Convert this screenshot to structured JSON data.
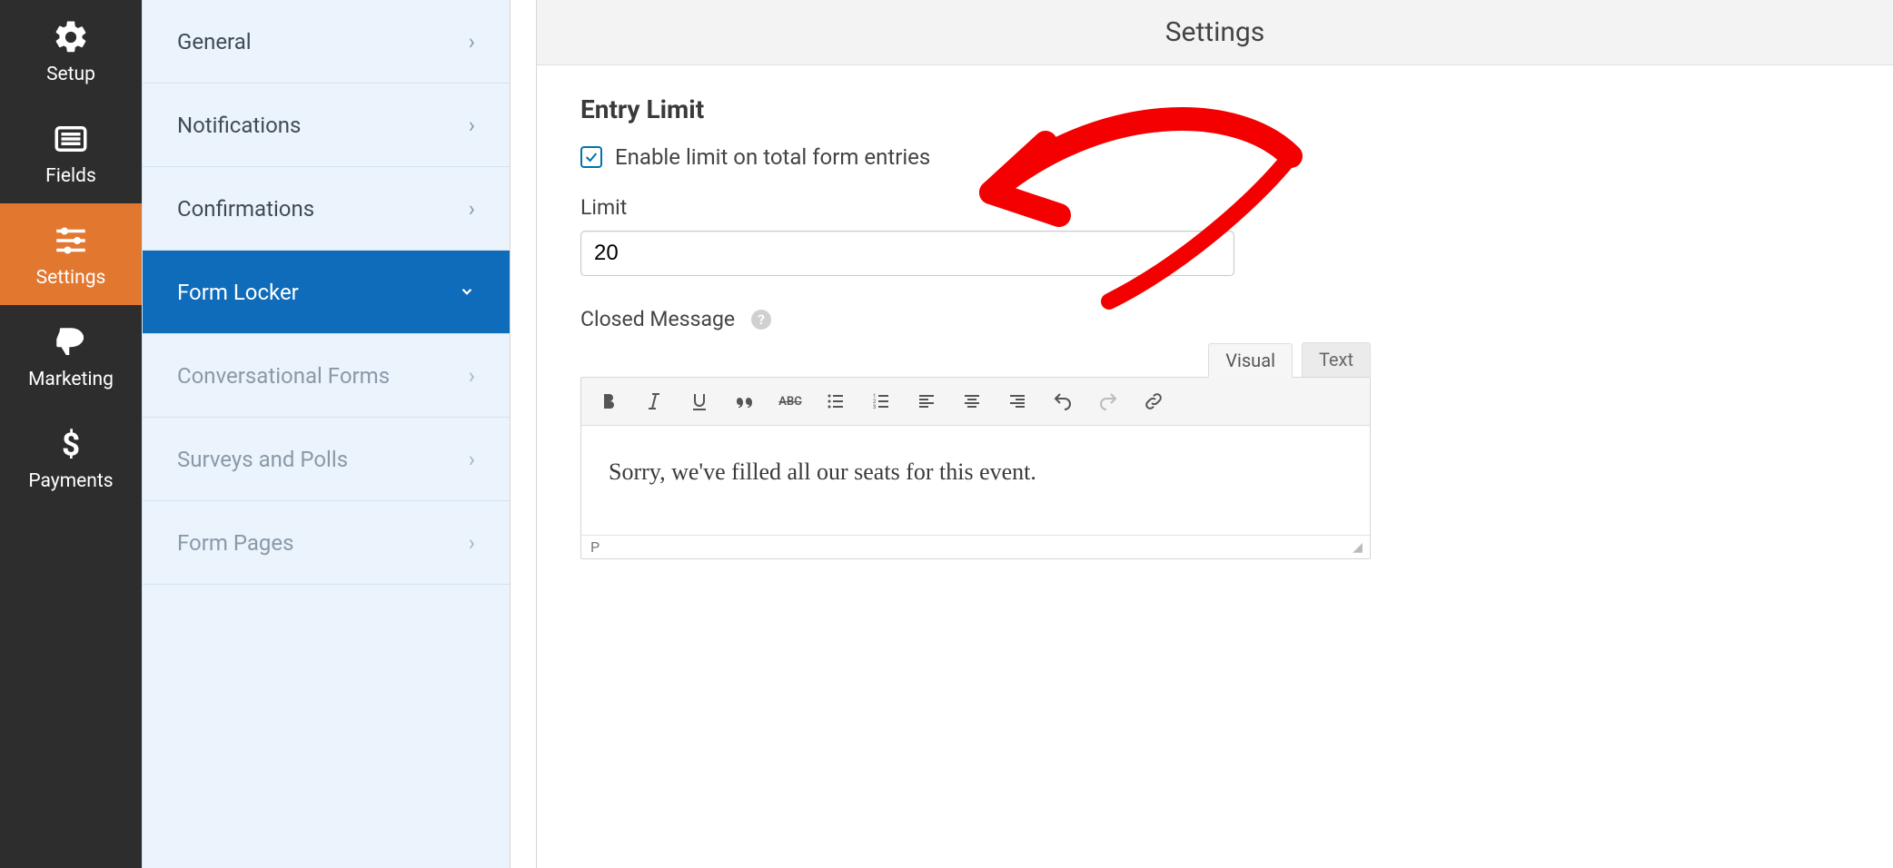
{
  "header": {
    "title": "Settings"
  },
  "nav": {
    "items": [
      {
        "label": "Setup"
      },
      {
        "label": "Fields"
      },
      {
        "label": "Settings"
      },
      {
        "label": "Marketing"
      },
      {
        "label": "Payments"
      }
    ]
  },
  "submenu": {
    "items": [
      {
        "label": "General"
      },
      {
        "label": "Notifications"
      },
      {
        "label": "Confirmations"
      },
      {
        "label": "Form Locker"
      },
      {
        "label": "Conversational Forms"
      },
      {
        "label": "Surveys and Polls"
      },
      {
        "label": "Form Pages"
      }
    ]
  },
  "section": {
    "heading": "Entry Limit",
    "enable_label": "Enable limit on total form entries",
    "enable_checked": true,
    "limit_label": "Limit",
    "limit_value": "20",
    "closed_label": "Closed Message",
    "editor_tabs": {
      "visual": "Visual",
      "text": "Text"
    },
    "closed_message": "Sorry, we've filled all our seats for this event.",
    "status_path": "P"
  }
}
